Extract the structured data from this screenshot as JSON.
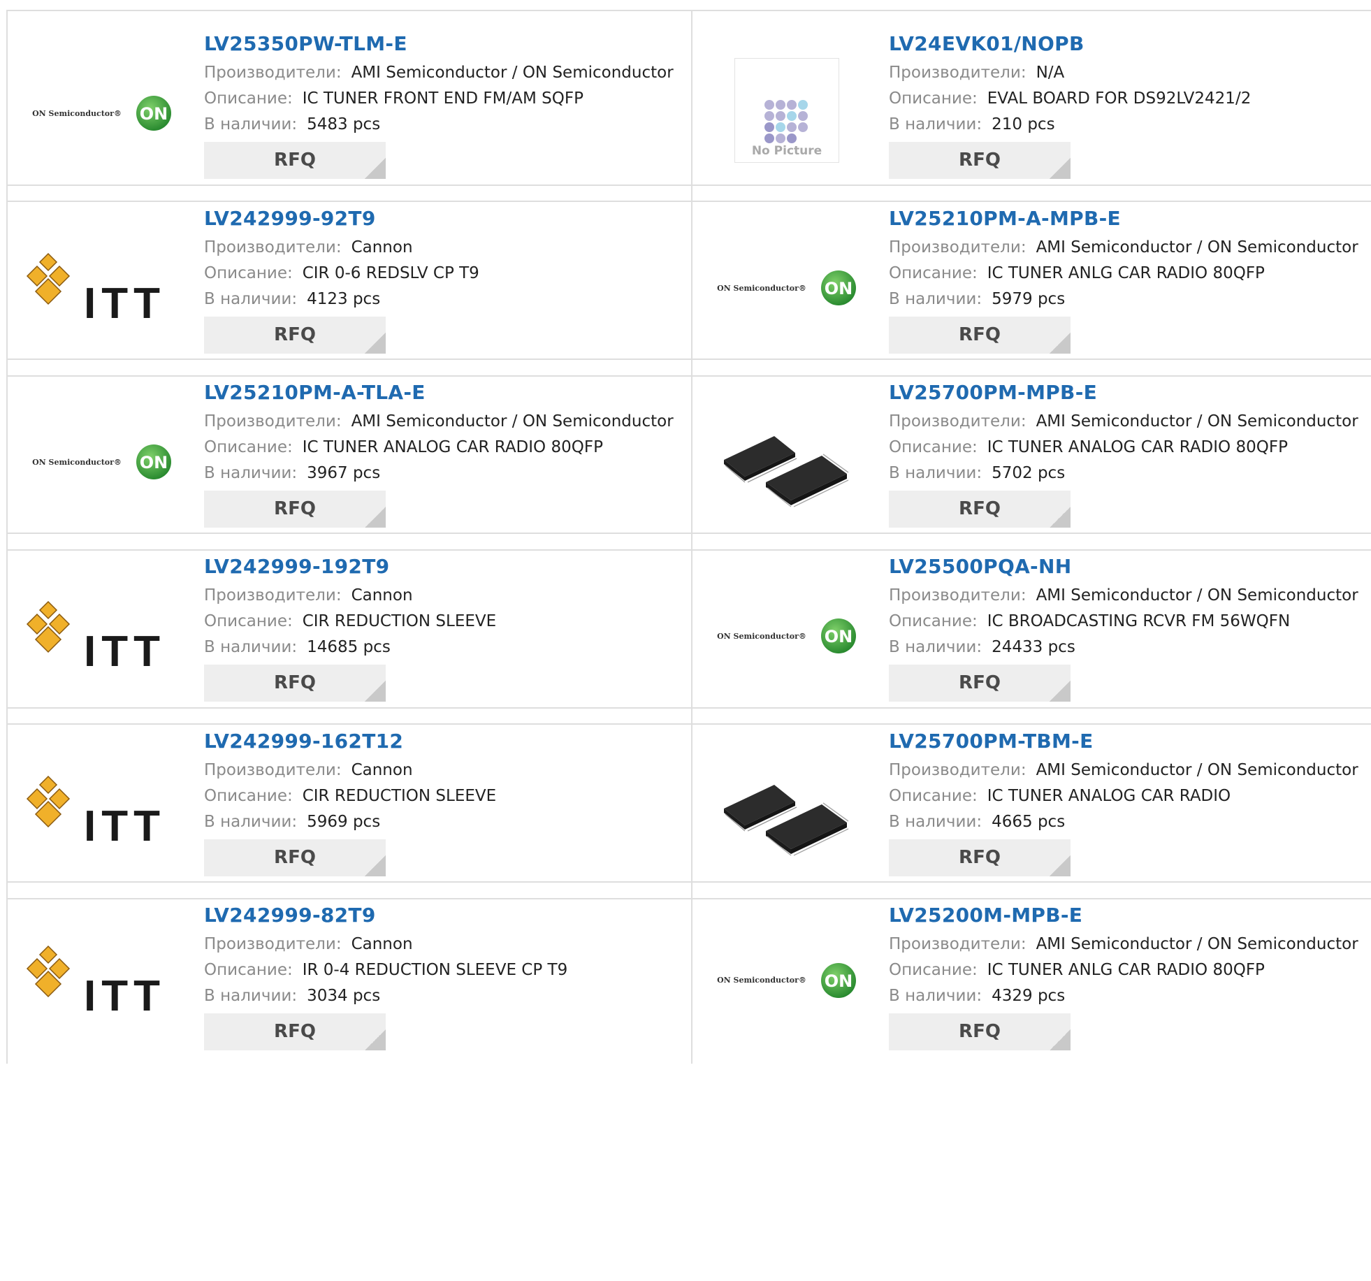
{
  "labels": {
    "manufacturer": "Производители:",
    "description": "Описание:",
    "stock": "В наличии:",
    "rfq": "RFQ",
    "on_wordmark": "ON Semiconductor®",
    "no_picture": "No Picture",
    "itt_wordmark": "ITT",
    "on_badge": "ON"
  },
  "colors": {
    "link": "#1f6ab0",
    "border": "#dedede",
    "button_bg": "#eeeeee",
    "label_gray": "#8a8a8a",
    "on_green": "#3a9b3c",
    "itt_gold": "#f0b02a"
  },
  "rows": [
    {
      "left": {
        "part": "LV25350PW-TLM-E",
        "manufacturer": "AMI Semiconductor / ON Semiconductor",
        "description": "IC TUNER FRONT END FM/AM SQFP",
        "stock": "5483 pcs",
        "logo": "on-semi-logo"
      },
      "right": {
        "part": "LV24EVK01/NOPB",
        "manufacturer": "N/A",
        "description": "EVAL BOARD FOR DS92LV2421/2",
        "stock": "210 pcs",
        "logo": "no-picture"
      }
    },
    {
      "left": {
        "part": "LV242999-92T9",
        "manufacturer": "Cannon",
        "description": "CIR 0-6 REDSLV CP T9",
        "stock": "4123 pcs",
        "logo": "itt-logo"
      },
      "right": {
        "part": "LV25210PM-A-MPB-E",
        "manufacturer": "AMI Semiconductor / ON Semiconductor",
        "description": "IC TUNER ANLG CAR RADIO 80QFP",
        "stock": "5979 pcs",
        "logo": "on-semi-logo"
      }
    },
    {
      "left": {
        "part": "LV25210PM-A-TLA-E",
        "manufacturer": "AMI Semiconductor / ON Semiconductor",
        "description": "IC TUNER ANALOG CAR RADIO 80QFP",
        "stock": "3967 pcs",
        "logo": "on-semi-logo"
      },
      "right": {
        "part": "LV25700PM-MPB-E",
        "manufacturer": "AMI Semiconductor / ON Semiconductor",
        "description": "IC TUNER ANALOG CAR RADIO 80QFP",
        "stock": "5702 pcs",
        "logo": "chip-photo"
      }
    },
    {
      "left": {
        "part": "LV242999-192T9",
        "manufacturer": "Cannon",
        "description": "CIR REDUCTION SLEEVE",
        "stock": "14685 pcs",
        "logo": "itt-logo"
      },
      "right": {
        "part": "LV25500PQA-NH",
        "manufacturer": "AMI Semiconductor / ON Semiconductor",
        "description": "IC BROADCASTING RCVR FM 56WQFN",
        "stock": "24433 pcs",
        "logo": "on-semi-logo"
      }
    },
    {
      "left": {
        "part": "LV242999-162T12",
        "manufacturer": "Cannon",
        "description": "CIR REDUCTION SLEEVE",
        "stock": "5969 pcs",
        "logo": "itt-logo"
      },
      "right": {
        "part": "LV25700PM-TBM-E",
        "manufacturer": "AMI Semiconductor / ON Semiconductor",
        "description": "IC TUNER ANALOG CAR RADIO",
        "stock": "4665 pcs",
        "logo": "chip-photo"
      }
    },
    {
      "left": {
        "part": "LV242999-82T9",
        "manufacturer": "Cannon",
        "description": "IR 0-4 REDUCTION SLEEVE CP T9",
        "stock": "3034 pcs",
        "logo": "itt-logo"
      },
      "right": {
        "part": "LV25200M-MPB-E",
        "manufacturer": "AMI Semiconductor / ON Semiconductor",
        "description": "IC TUNER ANLG CAR RADIO 80QFP",
        "stock": "4329 pcs",
        "logo": "on-semi-logo"
      }
    }
  ]
}
